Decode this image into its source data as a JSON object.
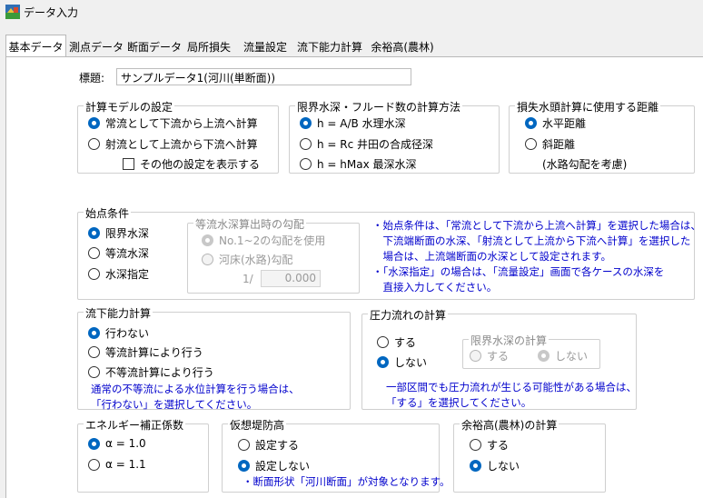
{
  "window": {
    "title": "データ入力",
    "icon": "app-icon"
  },
  "tabs": [
    "基本データ",
    "測点データ",
    "断面データ",
    "局所損失",
    "流量設定",
    "流下能力計算",
    "余裕高(農林)"
  ],
  "header": {
    "label": "標題:",
    "value": "サンプルデータ1(河川(単断面))"
  },
  "model": {
    "title": "計算モデルの設定",
    "options": [
      "常流として下流から上流へ計算",
      "射流として上流から下流へ計算"
    ],
    "selected": 0,
    "checkbox_label": "その他の設定を表示する",
    "checkbox_checked": false
  },
  "critical": {
    "title": "限界水深・フルード数の計算方法",
    "options": [
      "h = A/B 水理水深",
      "h = Rc 井田の合成径深",
      "h = hMax 最深水深"
    ],
    "selected": 0
  },
  "headloss": {
    "title": "損失水頭計算に使用する距離",
    "options": [
      "水平距離",
      "斜距離"
    ],
    "selected": 0,
    "sub_note": "(水路勾配を考慮)"
  },
  "start": {
    "title": "始点条件",
    "options": [
      "限界水深",
      "等流水深",
      "水深指定"
    ],
    "selected": 0,
    "sub": {
      "title": "等流水深算出時の勾配",
      "options": [
        "No.1~2の勾配を使用",
        "河床(水路)勾配"
      ],
      "selected": 0,
      "slope_prefix": "1/",
      "slope_value": "0.000"
    },
    "notes": [
      "・始点条件は、「常流として下流から上流へ計算」を選択した場合は、",
      "　下流端断面の水深、「射流として上流から下流へ計算」を選択した",
      "　場合は、上流端断面の水深として設定されます。",
      "・「水深指定」の場合は、「流量設定」画面で各ケースの水深を",
      "　直接入力してください。"
    ]
  },
  "flowcap": {
    "title": "流下能力計算",
    "options": [
      "行わない",
      "等流計算により行う",
      "不等流計算により行う"
    ],
    "selected": 0,
    "notes": [
      "通常の不等流による水位計算を行う場合は、",
      "「行わない」を選択してください。"
    ]
  },
  "pressure": {
    "title": "圧力流れの計算",
    "options": [
      "する",
      "しない"
    ],
    "selected": 1,
    "sub": {
      "title": "限界水深の計算",
      "options": [
        "する",
        "しない"
      ],
      "selected": 1
    },
    "notes": [
      "一部区間でも圧力流れが生じる可能性がある場合は、",
      "「する」を選択してください。"
    ]
  },
  "energy": {
    "title": "エネルギー補正係数",
    "options": [
      "α = 1.0",
      "α = 1.1"
    ],
    "selected": 0
  },
  "levee": {
    "title": "仮想堤防高",
    "options": [
      "設定する",
      "設定しない"
    ],
    "selected": 1,
    "note": "・断面形状「河川断面」が対象となります。"
  },
  "freeboard": {
    "title": "余裕高(農林)の計算",
    "options": [
      "する",
      "しない"
    ],
    "selected": 1
  }
}
